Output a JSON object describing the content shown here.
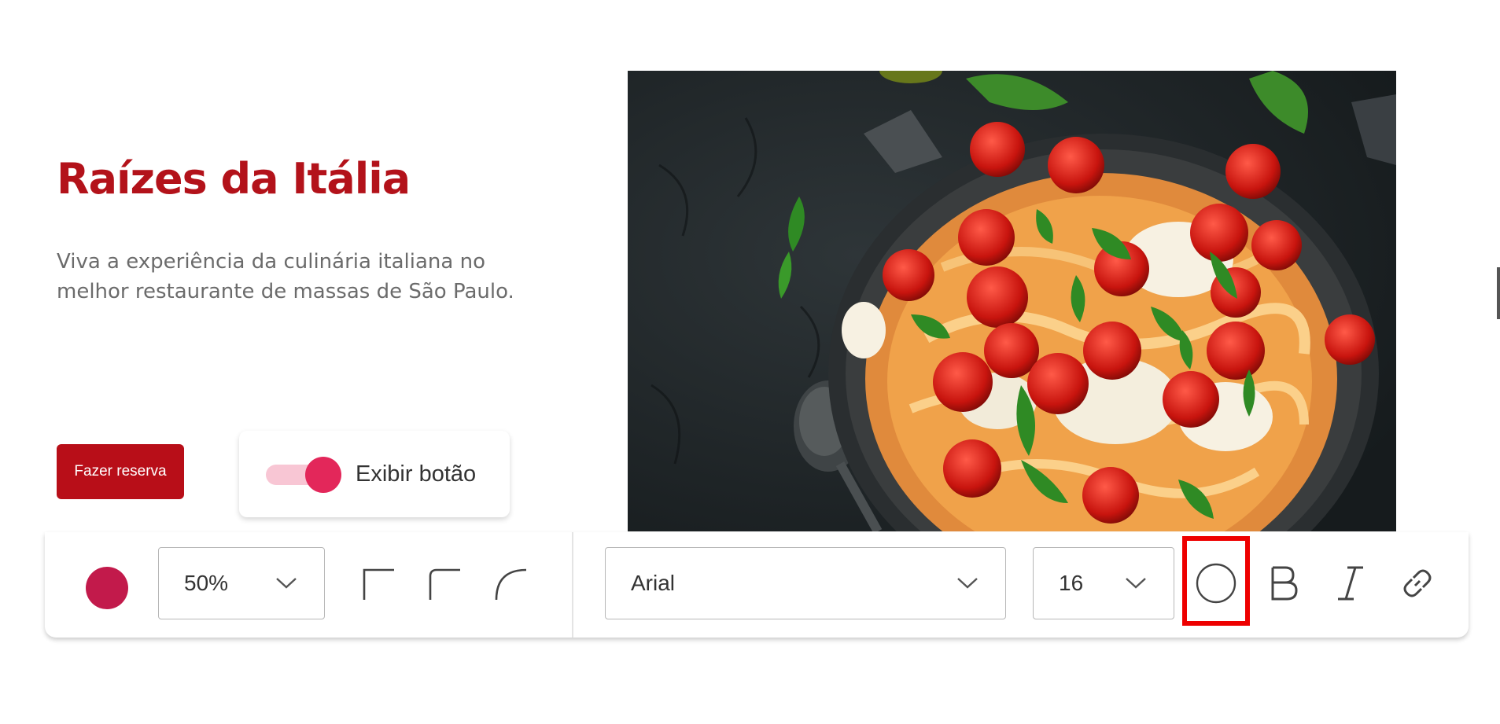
{
  "hero": {
    "title": "Raízes da Itália",
    "subtitle": "Viva a experiência da culinária italiana no melhor restaurante de massas de São Paulo.",
    "cta_label": "Fazer reserva",
    "image_icon": "pasta-dish-photo-icon"
  },
  "toggle": {
    "label": "Exibir botão",
    "on": true
  },
  "toolbar": {
    "color_value": "#c21a4b",
    "opacity_value": "50%",
    "corner_icons": [
      "square-corner-icon",
      "small-radius-corner-icon",
      "round-corner-icon"
    ],
    "font_value": "Arial",
    "font_size_value": "16",
    "format_icons": [
      "circle-icon",
      "bold-icon",
      "italic-icon",
      "link-icon"
    ]
  },
  "colors": {
    "brand_red": "#b80e18",
    "title_red": "#b3121a",
    "toggle_knob": "#e3275a",
    "toggle_track": "#f8c6d4",
    "highlight": "#ee0000"
  }
}
